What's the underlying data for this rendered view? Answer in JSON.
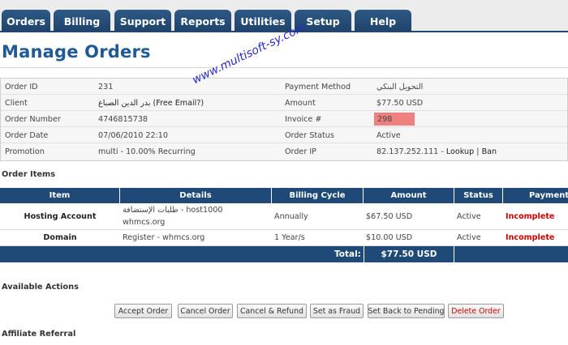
{
  "nav": {
    "tabs": [
      {
        "label": "Orders"
      },
      {
        "label": "Billing"
      },
      {
        "label": "Support"
      },
      {
        "label": "Reports"
      },
      {
        "label": "Utilities"
      },
      {
        "label": "Setup"
      },
      {
        "label": "Help"
      }
    ]
  },
  "page": {
    "title": "Manage Orders",
    "watermark": "www.multisoft-sy.com"
  },
  "info": {
    "rows": [
      {
        "label1": "Order ID",
        "value1": "231",
        "label2": "Payment Method",
        "value2": "التحويل البنكي"
      },
      {
        "label1": "Client",
        "value1": "بدر الدين الصباغ (Free Email?)",
        "label2": "Amount",
        "value2": "$77.50 USD"
      },
      {
        "label1": "Order Number",
        "value1": "4746815738",
        "label2": "Invoice #",
        "value2": "298"
      },
      {
        "label1": "Order Date",
        "value1": "07/06/2010 22:10",
        "label2": "Order Status",
        "value2": "Active"
      },
      {
        "label1": "Promotion",
        "value1": "multi - 10.00% Recurring",
        "label2": "Order IP",
        "value2": "82.137.252.111"
      }
    ],
    "ip_sep1": " - ",
    "ip_lookup": "Lookup",
    "ip_sep2": " | ",
    "ip_ban": "Ban"
  },
  "order_items": {
    "heading": "Order Items",
    "columns": [
      "Item",
      "Details",
      "Billing Cycle",
      "Amount",
      "Status",
      "Payment S"
    ],
    "rows": [
      {
        "item": "Hosting Account",
        "details_line1": "طلبات الإستضافة - host1000",
        "details_line2": "whmcs.org",
        "cycle": "Annually",
        "amount": "$67.50 USD",
        "status": "Active",
        "payment": "Incomplete"
      },
      {
        "item": "Domain",
        "details_line1": "Register - whmcs.org",
        "details_line2": "",
        "cycle": "1 Year/s",
        "amount": "$10.00 USD",
        "status": "Active",
        "payment": "Incomplete"
      }
    ],
    "total_label": "Total:",
    "total_value": "$77.50 USD"
  },
  "actions": {
    "heading": "Available Actions",
    "buttons": {
      "accept": "Accept Order",
      "cancel": "Cancel Order",
      "cancel_refund": "Cancel & Refund",
      "fraud": "Set as Fraud",
      "pending": "Set Back to Pending",
      "delete": "Delete Order"
    }
  },
  "affiliate": {
    "heading": "Affiliate Referral"
  },
  "colors": {
    "nav": "#1f4a78",
    "title": "#1f5a96",
    "invoice_highlight": "#f08080",
    "incomplete": "#cc0000"
  }
}
